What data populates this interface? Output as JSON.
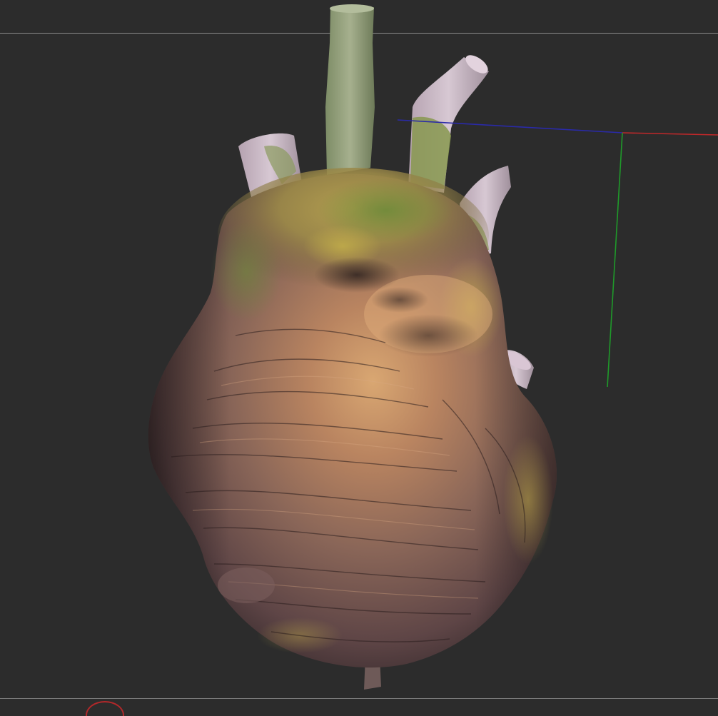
{
  "viewport": {
    "background": "#2c2c2c",
    "guide_color": "#8a8a8a"
  },
  "model": {
    "subject": "3d-heart-model",
    "palette": {
      "body_dark": "#5a4142",
      "body_mid": "#8a6a5a",
      "body_warm": "#c9925e",
      "body_highlight": "#e0b07a",
      "moss_green": "#6e7a3a",
      "vessel_pale": "#c8b7c2",
      "vessel_green": "#8a9a6a"
    }
  },
  "axis_gizmo": {
    "x_color": "#c0282a",
    "y_color": "#1f9a2a",
    "z_color": "#2a2aa8"
  },
  "corner_indicator": {
    "color": "#b0282a",
    "icon": "record-circle-icon"
  }
}
